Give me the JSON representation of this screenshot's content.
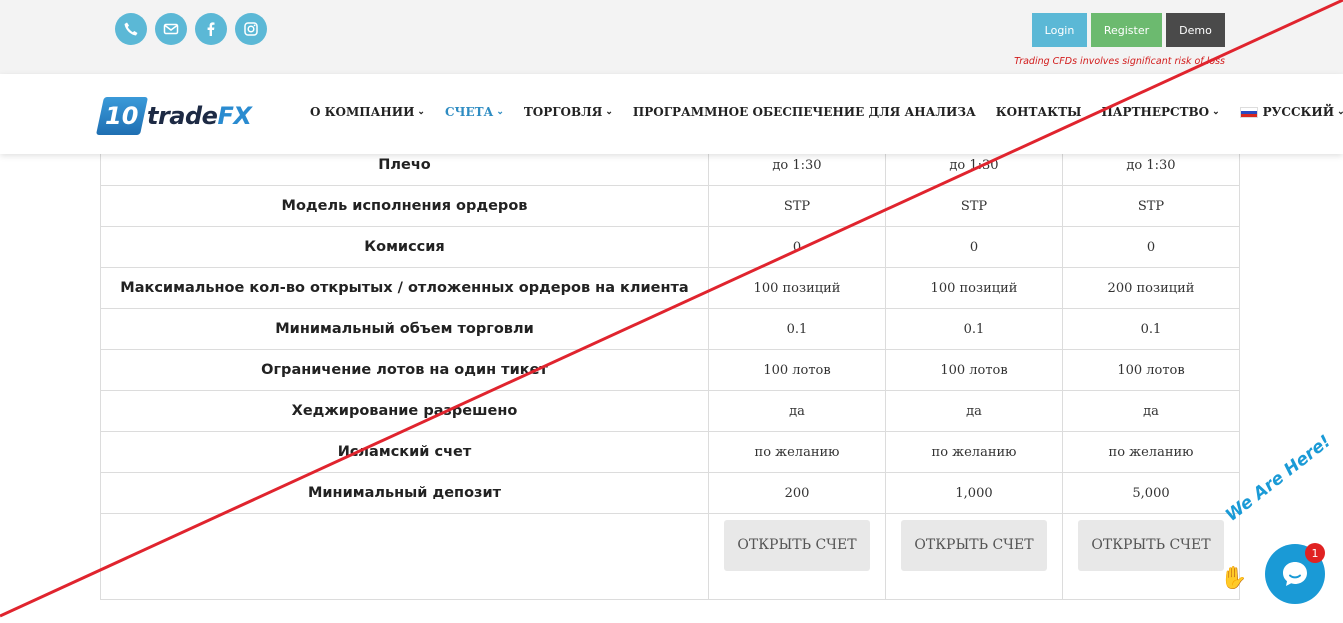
{
  "topbar": {
    "social": [
      {
        "icon": "phone-icon"
      },
      {
        "icon": "mail-icon"
      },
      {
        "icon": "facebook-icon"
      },
      {
        "icon": "instagram-icon"
      }
    ],
    "login_label": "Login",
    "register_label": "Register",
    "demo_label": "Demo",
    "risk_warning": "Trading CFDs involves significant risk of loss",
    "colors": {
      "login": "#5bb8d6",
      "register": "#6cba6f",
      "demo": "#4a4a4a",
      "risk": "#d21c1c"
    }
  },
  "header": {
    "logo": {
      "badge": "10",
      "text_main": "trade",
      "text_accent": "FX"
    },
    "nav": [
      {
        "label": "О КОМПАНИИ",
        "dropdown": true,
        "active": false
      },
      {
        "label": "СЧЕТА",
        "dropdown": true,
        "active": true
      },
      {
        "label": "ТОРГОВЛЯ",
        "dropdown": true,
        "active": false
      },
      {
        "label": "ПРОГРАММНОЕ ОБЕСПЕЧЕНИЕ ДЛЯ АНАЛИЗА",
        "dropdown": false,
        "active": false
      },
      {
        "label": "КОНТАКТЫ",
        "dropdown": false,
        "active": false
      },
      {
        "label": "ПАРТНЕРСТВО",
        "dropdown": true,
        "active": false
      },
      {
        "label": "РУССКИЙ",
        "dropdown": true,
        "active": false,
        "flag": "ru"
      }
    ],
    "accent_color": "#2e8cc2"
  },
  "table": {
    "rows": [
      {
        "label": "Плечо",
        "values": [
          "до 1:30",
          "до 1:30",
          "до 1:30"
        ]
      },
      {
        "label": "Модель исполнения ордеров",
        "values": [
          "STP",
          "STP",
          "STP"
        ]
      },
      {
        "label": "Комиссия",
        "values": [
          "0",
          "0",
          "0"
        ]
      },
      {
        "label": "Максимальное кол-во открытых / отложенных ордеров на клиента",
        "values": [
          "100 позиций",
          "100 позиций",
          "200 позиций"
        ]
      },
      {
        "label": "Минимальный объем торговли",
        "values": [
          "0.1",
          "0.1",
          "0.1"
        ]
      },
      {
        "label": "Ограничение лотов на один тикет",
        "values": [
          "100 лотов",
          "100 лотов",
          "100 лотов"
        ]
      },
      {
        "label": "Хеджирование разрешено",
        "values": [
          "да",
          "да",
          "да"
        ]
      },
      {
        "label": "Исламский счет",
        "values": [
          "по желанию",
          "по желанию",
          "по желанию"
        ]
      },
      {
        "label": "Минимальный депозит",
        "values": [
          "200",
          "1,000",
          "5,000"
        ]
      }
    ],
    "open_account_label": "ОТКРЫТЬ СЧЕТ"
  },
  "chat_widget": {
    "tagline": "We Are Here!",
    "unread_count": "1",
    "color": "#1a9ad6"
  },
  "overlay": {
    "slash_color": "#e0242e"
  }
}
